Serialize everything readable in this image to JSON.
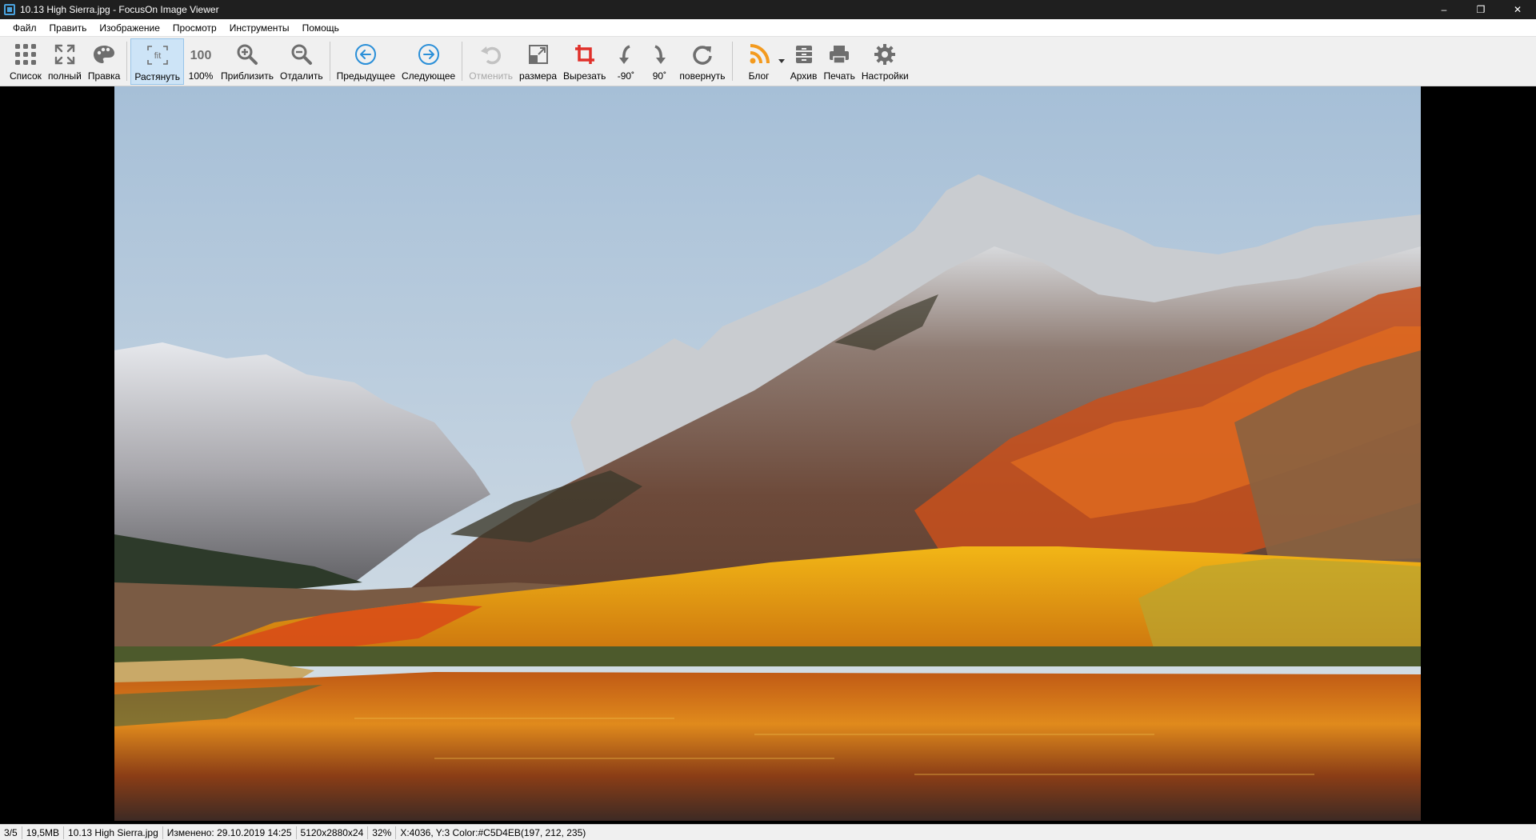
{
  "window": {
    "title": "10.13 High Sierra.jpg - FocusOn Image Viewer",
    "minimize": "–",
    "restore": "❐",
    "close": "✕"
  },
  "menu": [
    "Файл",
    "Править",
    "Изображение",
    "Просмотр",
    "Инструменты",
    "Помощь"
  ],
  "toolbar": {
    "list": "Список",
    "full": "полный",
    "edit": "Правка",
    "fit": "Растянуть",
    "fit_icon_text": "fit",
    "actual": "100%",
    "actual_icon_text": "100",
    "zoom_in": "Приблизить",
    "zoom_out": "Отдалить",
    "prev": "Предыдущее",
    "next": "Следующее",
    "undo": "Отменить",
    "resize": "размера",
    "crop": "Вырезать",
    "rot_left": "-90˚",
    "rot_right": "90˚",
    "rotate": "повернуть",
    "blog": "Блог",
    "archive": "Архив",
    "print": "Печать",
    "settings": "Настройки"
  },
  "icons": {
    "accent_blue": "#2a8fd8",
    "crop_red": "#e0302a",
    "rss_orange": "#f39a1e",
    "gray": "#6e6e6e"
  },
  "status": {
    "index": "3/5",
    "size": "19,5MB",
    "filename": "10.13 High Sierra.jpg",
    "modified": "Изменено: 29.10.2019 14:25",
    "dimensions": "5120x2880x24",
    "zoom": "32%",
    "pixel": "X:4036, Y:3 Color:#C5D4EB(197, 212, 235)"
  }
}
